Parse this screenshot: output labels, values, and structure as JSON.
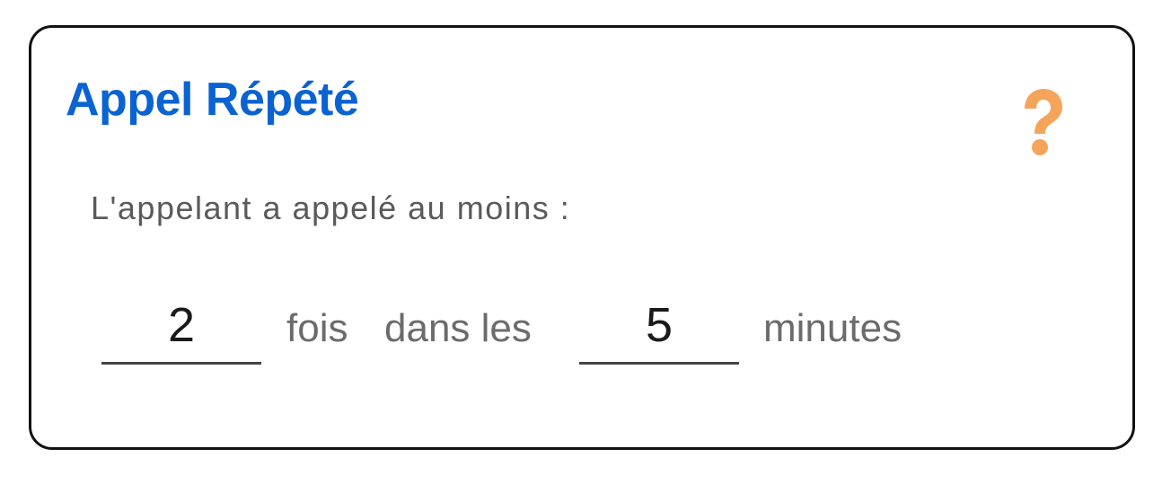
{
  "title": "Appel Répété",
  "subtitle": "L'appelant a appelé au moins :",
  "times_field": {
    "value": "2"
  },
  "times_label": "fois",
  "within_label": "dans les",
  "minutes_field": {
    "value": "5"
  },
  "minutes_label": "minutes",
  "help_icon": {
    "name": "help-icon",
    "color": "#f4a55a"
  },
  "colors": {
    "title": "#0a63d1",
    "text": "#5a5a5a",
    "border": "#111111"
  }
}
